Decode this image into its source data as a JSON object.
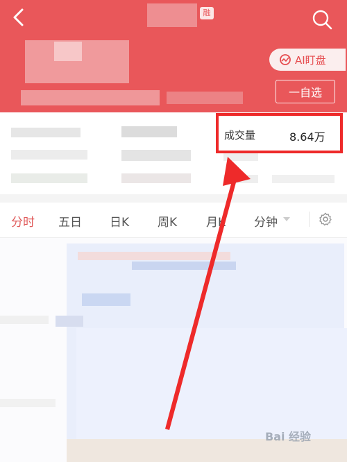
{
  "header": {
    "title_tag": "融",
    "ai_button_label": "AI盯盘",
    "watchlist_button_label": "一自选"
  },
  "stats": {
    "volume_label": "成交量",
    "volume_value": "8.64万"
  },
  "tabs": [
    {
      "label": "分时",
      "active": true
    },
    {
      "label": "五日",
      "active": false
    },
    {
      "label": "日K",
      "active": false
    },
    {
      "label": "周K",
      "active": false
    },
    {
      "label": "月K",
      "active": false
    },
    {
      "label": "分钟",
      "active": false
    }
  ],
  "watermark": "Bai 经验",
  "colors": {
    "header_bg": "#e9575a",
    "accent": "#e05a5a",
    "highlight": "#ee2a2a"
  }
}
